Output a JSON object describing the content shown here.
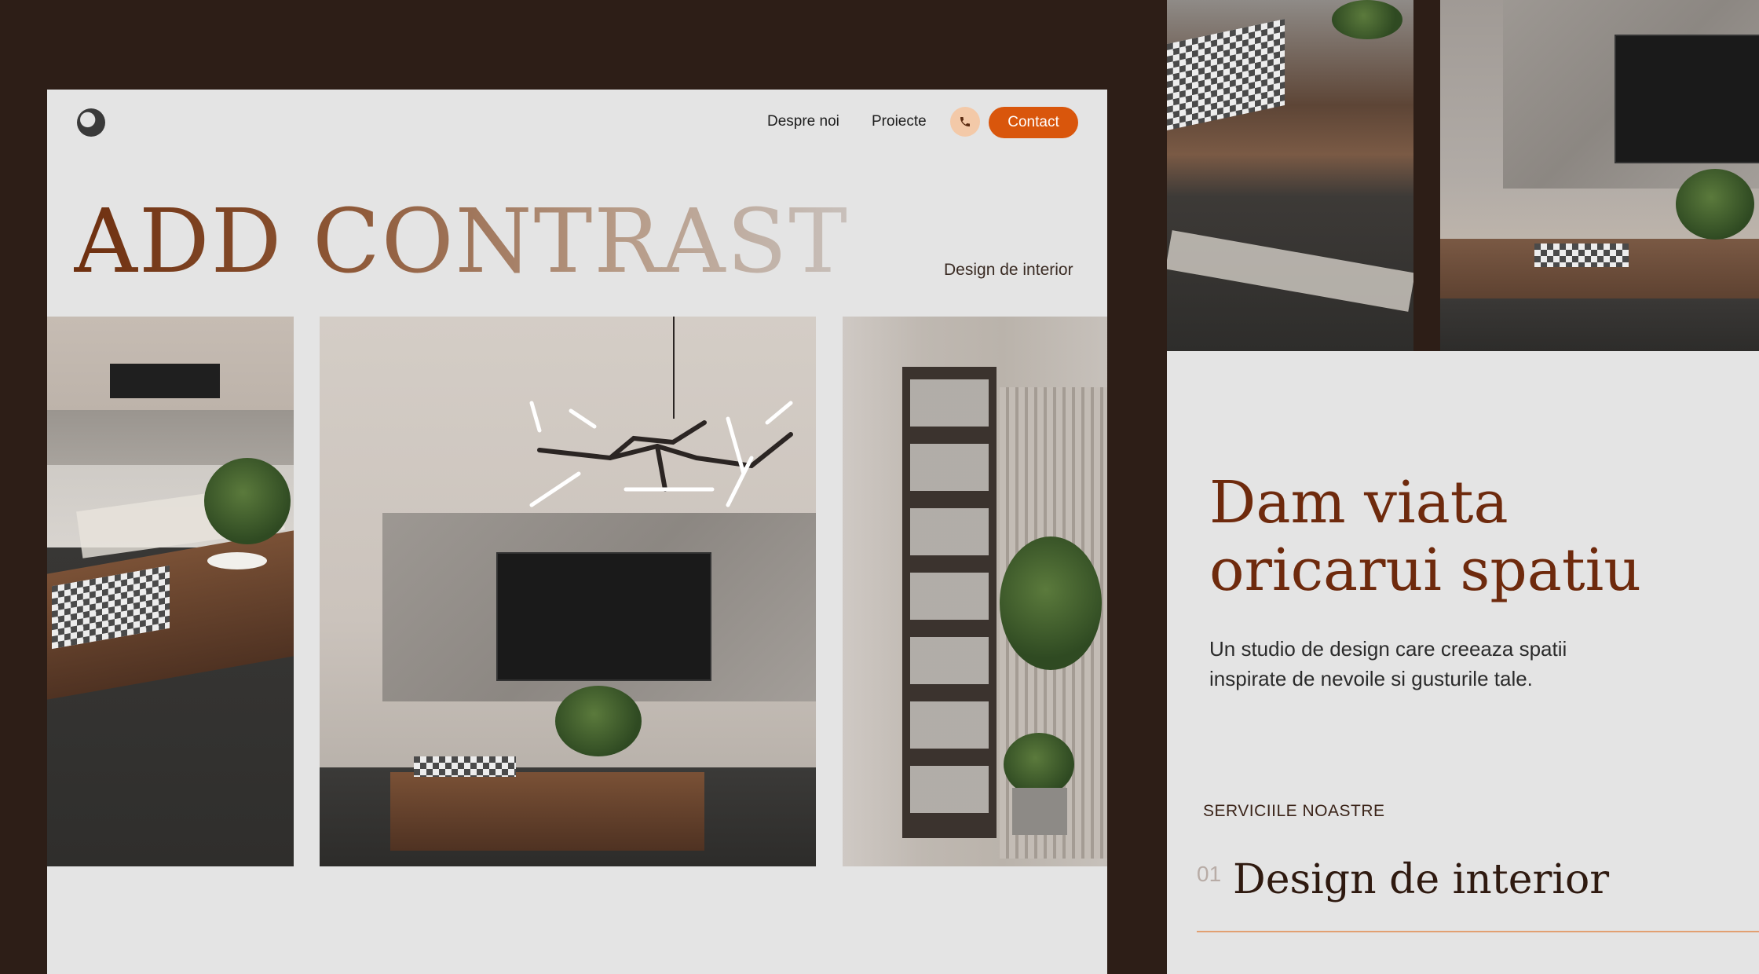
{
  "nav": {
    "items": [
      "Despre noi",
      "Proiecte"
    ],
    "contact_label": "Contact"
  },
  "hero": {
    "title": "ADD CONTRAST",
    "tagline": "Design de interior"
  },
  "about": {
    "headline": "Dam viata oricarui spatiu",
    "description": "Un studio de design care creeaza spatii inspirate de nevoile si gusturile tale."
  },
  "services": {
    "label": "SERVICIILE NOASTRE",
    "items": [
      {
        "number": "01",
        "title": "Design de interior"
      }
    ]
  },
  "colors": {
    "background": "#2d1e17",
    "page": "#e4e4e4",
    "accent": "#d9560c",
    "accent_light": "#f3c9a8",
    "brand_brown": "#6e2a0d"
  },
  "icons": [
    "logo-mark",
    "phone-icon"
  ]
}
